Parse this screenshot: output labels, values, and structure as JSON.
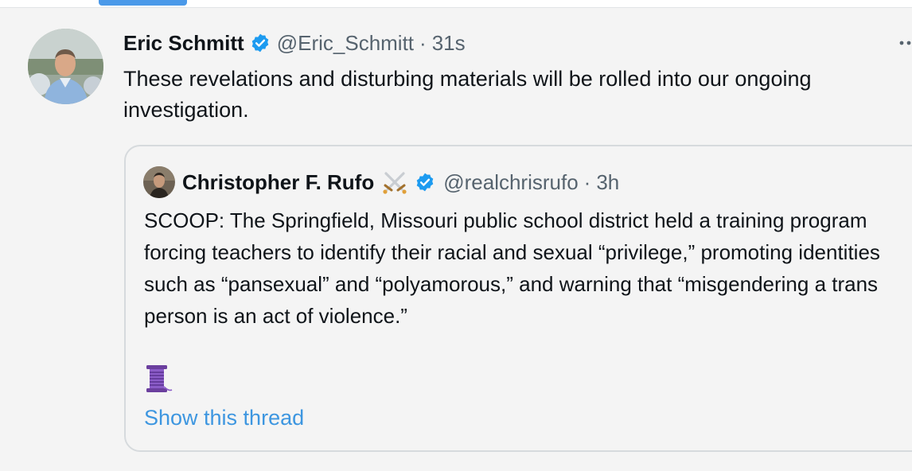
{
  "colors": {
    "accent": "#4a99e9",
    "verified": "#1d9bf0",
    "link": "#3d96e0",
    "secondary_text": "#56636e",
    "background": "#f4f4f4"
  },
  "tweet": {
    "author_name": "Eric Schmitt",
    "verified_icon": "verified-badge-icon",
    "handle": "@Eric_Schmitt",
    "separator": "·",
    "time": "31s",
    "text": "These revelations and disturbing materials will be rolled into our ongoing investigation."
  },
  "quoted_tweet": {
    "author_name": "Christopher F. Rufo",
    "emoji_icon": "crossed-swords-icon",
    "verified_icon": "verified-badge-icon",
    "handle": "@realchrisrufo",
    "separator": "·",
    "time": "3h",
    "text": "SCOOP: The Springfield, Missouri public school district held a training program forcing teachers to identify their racial and sexual “privilege,” promoting identities such as “pansexual” and “polyamorous,” and warning that “misgendering a trans person is an act of violence.”",
    "thread_icon": "thread-spool-icon",
    "show_thread_label": "Show this thread"
  }
}
